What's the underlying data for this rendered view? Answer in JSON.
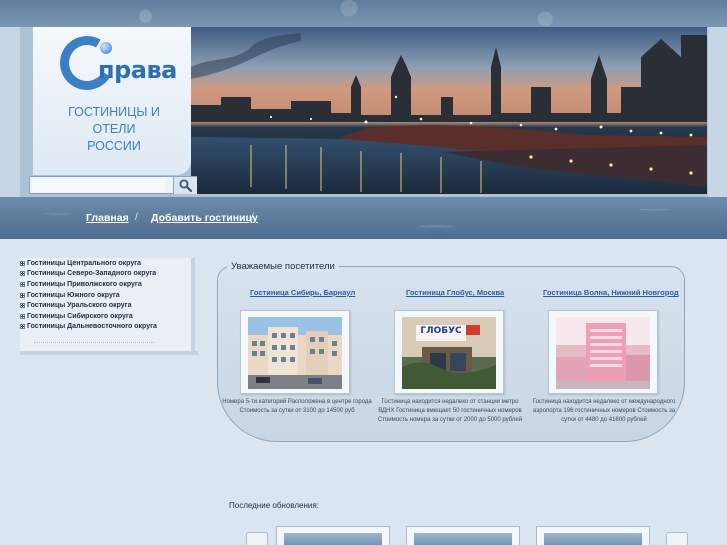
{
  "logo": {
    "text": "права"
  },
  "site_title": [
    "ГОСТИНИЦЫ И",
    "ОТЕЛИ",
    "РОССИИ"
  ],
  "search": {
    "value": "",
    "placeholder": ""
  },
  "nav": {
    "home": "Главная",
    "add_hotel": "Добавить гостиницу",
    "separator": "/"
  },
  "sidebar": {
    "items": [
      "Гостиницы Центрального округа",
      "Гостиницы Северо-Западного округа",
      "Гостиницы Приволжского округа",
      "Гостиницы Южного округа",
      "Гостиницы Уральского округа",
      "Гостиницы Сибирского округа",
      "Гостиницы Дальневосточного округа"
    ]
  },
  "visitors": {
    "title": "Уважаемые посетители",
    "hotels": [
      {
        "name": "Гостиница Сибирь, Барнаул",
        "description": "Номера 5-ти категорий Расположена в центре города Стоимость за сутки от 3100 до 14500 руб"
      },
      {
        "name": "Гостиница Глобус, Москва",
        "description": "Гостиница находится недалеко от станции метро ВДНХ Гостиница вмещает 50 гостиничных номеров Стоимость номера за сутки от 2000 до 5000 рублей"
      },
      {
        "name": "Гостиница Волна, Нижний Новгород",
        "description": "Гостиница находится недалеко от международного аэропорта 196 гостиничных номеров Стоимость за сутки от 4480 до 41600 рублей"
      }
    ],
    "thumb_sign": "ГЛОБУС"
  },
  "updates": {
    "label": "Последние обновления:"
  },
  "colors": {
    "accent": "#2a5ea3",
    "brand_blue": "#3d7fc7",
    "band": "#5f7d9b"
  },
  "icons": {
    "search": "magnifier-icon",
    "expand": "plus-box-icon"
  }
}
